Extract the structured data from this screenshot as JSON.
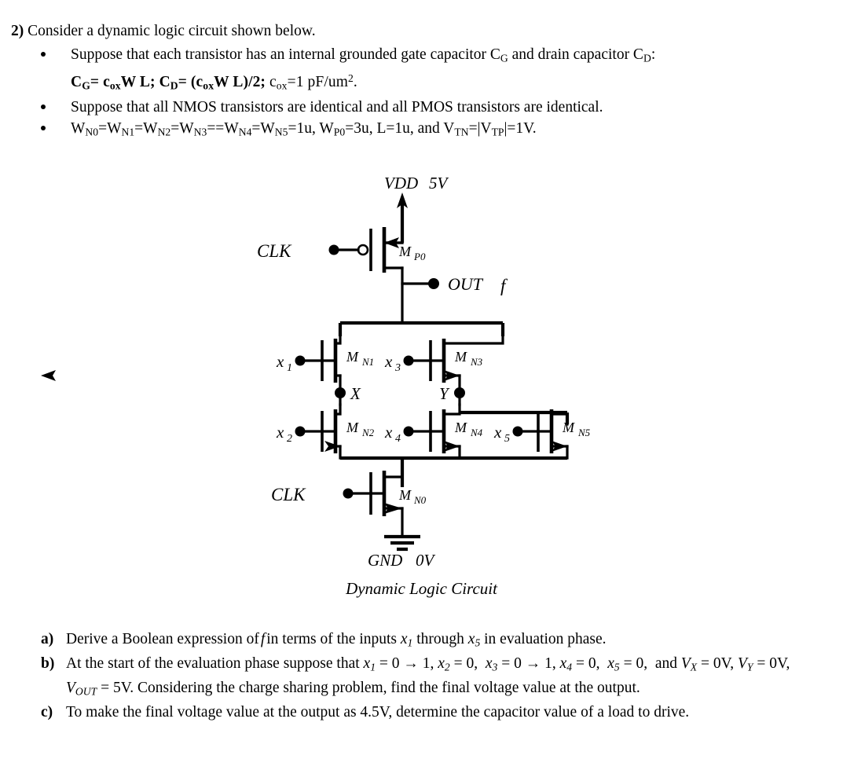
{
  "question": {
    "number": "2)",
    "stem": "Consider a dynamic logic circuit shown below.",
    "bullets": [
      {
        "id": "bullet-capacitors",
        "text_part1": "Suppose that each transistor has an internal grounded gate capacitor C",
        "sub1": "G",
        "text_part2": " and drain capacitor C",
        "sub2": "D",
        "text_part3": ":",
        "formula": "CG= coxW L;  CD= (coxW L)/2; cox=1 pF/um2.",
        "formula_tokens": {
          "cg": "C",
          "cg_sub": "G",
          "eq1": "= ",
          "cox1": "c",
          "cox1_sub": "ox",
          "wl1": "W L;  ",
          "cd": "C",
          "cd_sub": "D",
          "eq2": "= (",
          "cox2": "c",
          "cox2_sub": "ox",
          "wl2": "W L)/2; ",
          "cox3": "c",
          "cox3_sub": "ox",
          "val": "=1 pF/um",
          "val_sup": "2",
          "period": "."
        }
      },
      {
        "id": "bullet-identical",
        "text": "Suppose that all NMOS transistors are identical and all PMOS transistors are identical."
      },
      {
        "id": "bullet-widths",
        "tokens": {
          "w0": "W",
          "w0_sub": "N0",
          "e0": "=",
          "w1": "W",
          "w1_sub": "N1",
          "e1": "=",
          "w2": "W",
          "w2_sub": "N2",
          "e2": "=",
          "w3": "W",
          "w3_sub": "N3",
          "e3": "==",
          "w4": "W",
          "w4_sub": "N4",
          "e4": "=",
          "w5": "W",
          "w5_sub": "N5",
          "e5": "=1u, ",
          "wp": "W",
          "wp_sub": "P0",
          "ep": "=3u, L=1u, and ",
          "vtn": "V",
          "vtn_sub": "TN",
          "bar1": "=|",
          "vtp": "V",
          "vtp_sub": "TP",
          "bar2": "|=1V."
        }
      }
    ]
  },
  "circuit": {
    "caption": "Dynamic Logic Circuit",
    "rail_top_label": "VDD",
    "rail_top_value": "5V",
    "rail_bottom_label": "GND",
    "rail_bottom_value": "0V",
    "clk_top_label": "CLK",
    "clk_bottom_label": "CLK",
    "out_label": "OUT",
    "out_func": "f",
    "node_x_label": "X",
    "node_y_label": "Y",
    "transistors": [
      {
        "name": "M",
        "sub": "P0",
        "type": "pmos"
      },
      {
        "name": "M",
        "sub": "N1",
        "type": "nmos"
      },
      {
        "name": "M",
        "sub": "N2",
        "type": "nmos"
      },
      {
        "name": "M",
        "sub": "N3",
        "type": "nmos"
      },
      {
        "name": "M",
        "sub": "N4",
        "type": "nmos"
      },
      {
        "name": "M",
        "sub": "N5",
        "type": "nmos"
      },
      {
        "name": "M",
        "sub": "N0",
        "type": "nmos"
      }
    ],
    "inputs": [
      {
        "name": "x",
        "sub": "1"
      },
      {
        "name": "x",
        "sub": "2"
      },
      {
        "name": "x",
        "sub": "3"
      },
      {
        "name": "x",
        "sub": "4"
      },
      {
        "name": "x",
        "sub": "5"
      }
    ],
    "colors": {
      "ink": "#000000",
      "paper": "#ffffff"
    }
  },
  "answers": [
    {
      "label": "a)",
      "id": "answer-a",
      "text": "Derive a Boolean expression of f in terms of the inputs x1 through x5 in evaluation phase."
    },
    {
      "label": "b)",
      "id": "answer-b",
      "text": "At the start of the evaluation phase suppose that x1 = 0 → 1, x2 = 0,  x3 = 0 → 1, x4 = 0,  x5 = 0,  and VX = 0V, VY = 0V, VOUT = 5V. Considering the charge sharing problem, find the final voltage value at the output."
    },
    {
      "label": "c)",
      "id": "answer-c",
      "text": "To make the final voltage value at the output as 4.5V, determine the capacitor value of a load to drive."
    }
  ]
}
